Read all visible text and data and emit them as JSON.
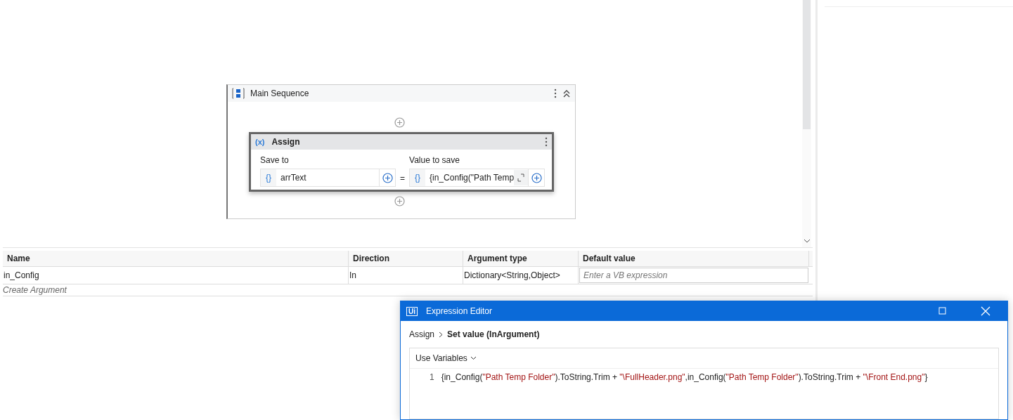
{
  "sequence": {
    "title": "Main Sequence",
    "activity": {
      "icon": "(x)",
      "brace": "{}",
      "title": "Assign",
      "save_to_label": "Save to",
      "save_to_value": "arrText",
      "value_label": "Value to save",
      "value": "{in_Config(\"Path Temp",
      "equals": "="
    }
  },
  "arguments": {
    "columns": [
      "Name",
      "Direction",
      "Argument type",
      "Default value"
    ],
    "rows": [
      {
        "name": "in_Config",
        "direction": "In",
        "type": "Dictionary<String,Object>",
        "default_placeholder": "Enter a VB expression"
      }
    ],
    "create_label": "Create Argument"
  },
  "dialog": {
    "logo": "Ui",
    "title": "Expression Editor",
    "breadcrumb": [
      "Assign",
      "Set value (InArgument)"
    ],
    "use_variables": "Use Variables",
    "lines": [
      {
        "number": "1",
        "tokens": [
          {
            "kind": "plain",
            "text": "{in_Config("
          },
          {
            "kind": "string",
            "text": "\"Path Temp Folder\""
          },
          {
            "kind": "plain",
            "text": ").ToString.Trim + "
          },
          {
            "kind": "string",
            "text": "\"\\FullHeader.png\""
          },
          {
            "kind": "plain",
            "text": ",in_Config("
          },
          {
            "kind": "string",
            "text": "\"Path Temp Folder\""
          },
          {
            "kind": "plain",
            "text": ").ToString.Trim + "
          },
          {
            "kind": "string",
            "text": "\"\\Front End.png\""
          },
          {
            "kind": "plain",
            "text": "}"
          }
        ]
      }
    ]
  }
}
